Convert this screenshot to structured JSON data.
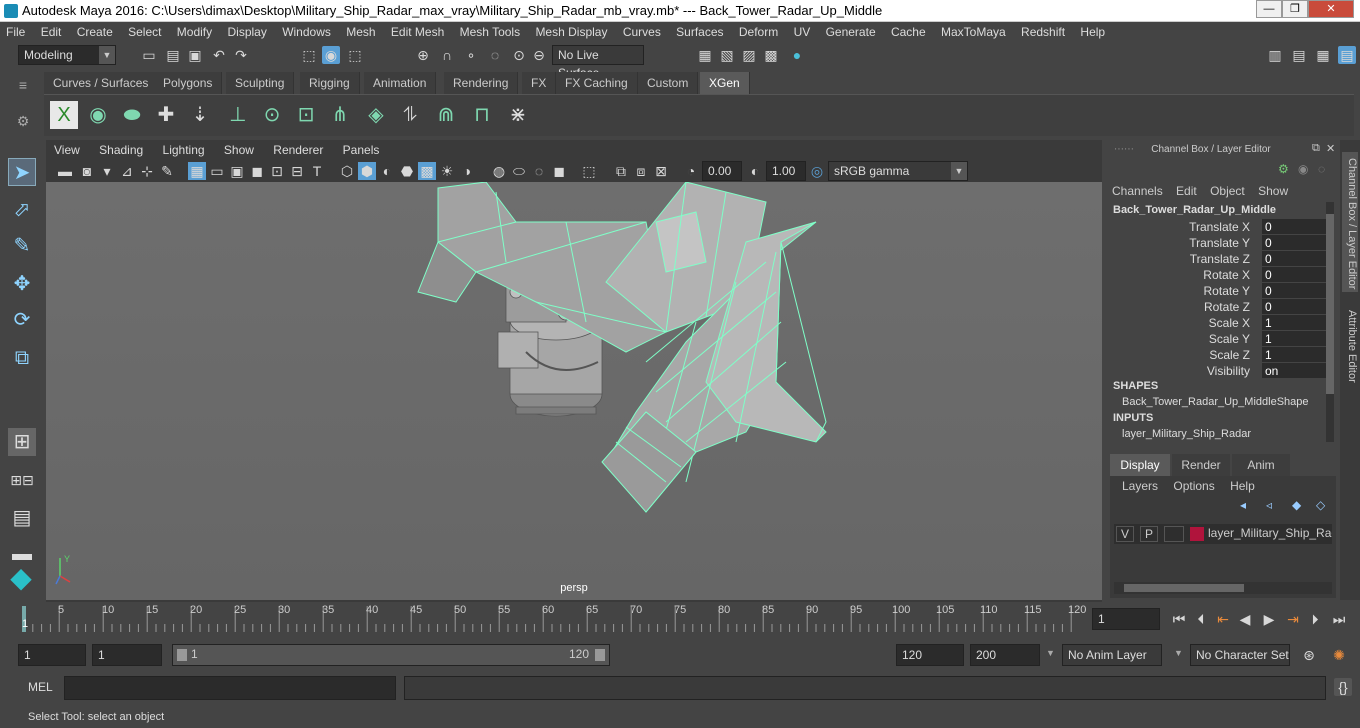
{
  "window": {
    "title": "Autodesk Maya 2016: C:\\Users\\dimax\\Desktop\\Military_Ship_Radar_max_vray\\Military_Ship_Radar_mb_vray.mb*   ---   Back_Tower_Radar_Up_Middle",
    "minimize": "—",
    "maximize": "❐",
    "close": "✕"
  },
  "menubar": [
    "File",
    "Edit",
    "Create",
    "Select",
    "Modify",
    "Display",
    "Windows",
    "Mesh",
    "Edit Mesh",
    "Mesh Tools",
    "Mesh Display",
    "Curves",
    "Surfaces",
    "Deform",
    "UV",
    "Generate",
    "Cache",
    "MaxToMaya",
    "Redshift",
    "Help"
  ],
  "statusline": {
    "mode": "Modeling",
    "live_surface": "No Live Surface"
  },
  "shelf_tabs": [
    {
      "label": "Curves / Surfaces",
      "active": false
    },
    {
      "label": "Polygons",
      "active": false
    },
    {
      "label": "Sculpting",
      "active": false
    },
    {
      "label": "Rigging",
      "active": false
    },
    {
      "label": "Animation",
      "active": false
    },
    {
      "label": "Rendering",
      "active": false
    },
    {
      "label": "FX",
      "active": false
    },
    {
      "label": "FX Caching",
      "active": false
    },
    {
      "label": "Custom",
      "active": false
    },
    {
      "label": "XGen",
      "active": true
    }
  ],
  "viewport": {
    "menu": [
      "View",
      "Shading",
      "Lighting",
      "Show",
      "Renderer",
      "Panels"
    ],
    "exposure": "0.00",
    "gamma": "1.00",
    "color_space": "sRGB gamma",
    "camera": "persp"
  },
  "channel_box": {
    "title": "Channel Box / Layer Editor",
    "menu": [
      "Channels",
      "Edit",
      "Object",
      "Show"
    ],
    "object": "Back_Tower_Radar_Up_Middle",
    "channels": [
      {
        "name": "Translate X",
        "value": "0"
      },
      {
        "name": "Translate Y",
        "value": "0"
      },
      {
        "name": "Translate Z",
        "value": "0"
      },
      {
        "name": "Rotate X",
        "value": "0"
      },
      {
        "name": "Rotate Y",
        "value": "0"
      },
      {
        "name": "Rotate Z",
        "value": "0"
      },
      {
        "name": "Scale X",
        "value": "1"
      },
      {
        "name": "Scale Y",
        "value": "1"
      },
      {
        "name": "Scale Z",
        "value": "1"
      },
      {
        "name": "Visibility",
        "value": "on"
      }
    ],
    "shapes_header": "SHAPES",
    "shape": "Back_Tower_Radar_Up_MiddleShape",
    "inputs_header": "INPUTS",
    "input": "layer_Military_Ship_Radar"
  },
  "layer_editor": {
    "tabs": [
      "Display",
      "Render",
      "Anim"
    ],
    "menu": [
      "Layers",
      "Options",
      "Help"
    ],
    "layer": {
      "v": "V",
      "p": "P",
      "name": "layer_Military_Ship_Radar",
      "color": "#b0143c"
    }
  },
  "side_tabs": [
    "Channel Box / Layer Editor",
    "Attribute Editor"
  ],
  "timeline": {
    "ticks": [
      "5",
      "10",
      "15",
      "20",
      "25",
      "30",
      "35",
      "40",
      "45",
      "50",
      "55",
      "60",
      "65",
      "70",
      "75",
      "80",
      "85",
      "90",
      "95",
      "100",
      "105",
      "110",
      "115",
      "120"
    ],
    "first": "1",
    "current_frame": "1"
  },
  "range": {
    "start": "1",
    "playback_start": "1",
    "slider_start": "1",
    "slider_end": "120",
    "playback_end": "120",
    "end": "200",
    "anim_layer": "No Anim Layer",
    "char_set": "No Character Set"
  },
  "cmdline": {
    "label": "MEL"
  },
  "help": "Select Tool: select an object",
  "colors": {
    "wire": "#7fffc8",
    "accent": "#5a9fd4"
  }
}
